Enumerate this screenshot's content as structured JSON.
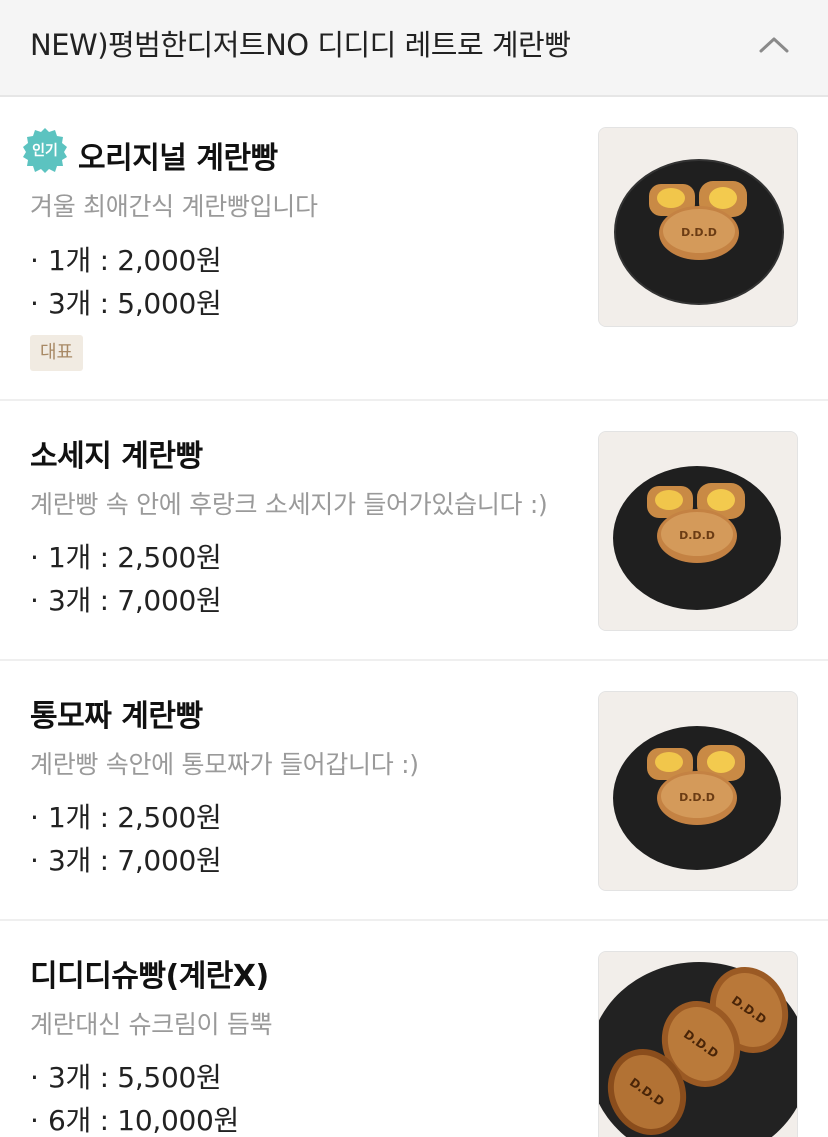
{
  "section": {
    "title": "NEW)평범한디저트NO 디디디 레트로 계란빵",
    "collapse_icon": "chevron-up-icon"
  },
  "items": [
    {
      "badge": "인기",
      "name": "오리지널 계란빵",
      "description": "겨울 최애간식 계란빵입니다",
      "prices": [
        "1개 : 2,000원",
        "3개 : 5,000원"
      ],
      "tag": "대표"
    },
    {
      "name": "소세지 계란빵",
      "description": "계란빵 속 안에 후랑크 소세지가 들어가있습니다 :)",
      "prices": [
        "1개 : 2,500원",
        "3개 : 7,000원"
      ]
    },
    {
      "name": "통모짜 계란빵",
      "description": "계란빵 속안에 통모짜가 들어갑니다 :)",
      "prices": [
        "1개 : 2,500원",
        "3개 : 7,000원"
      ]
    },
    {
      "name": "디디디슈빵(계란X)",
      "description": "계란대신 슈크림이 듬뿍",
      "prices": [
        "3개 : 5,500원",
        "6개 : 10,000원"
      ]
    }
  ],
  "colors": {
    "header_bg": "#f5f5f5",
    "badge_teal": "#5cc3c0",
    "tag_bg": "#f1ebe2",
    "tag_text": "#a88965",
    "desc_gray": "#9a9a9a"
  }
}
